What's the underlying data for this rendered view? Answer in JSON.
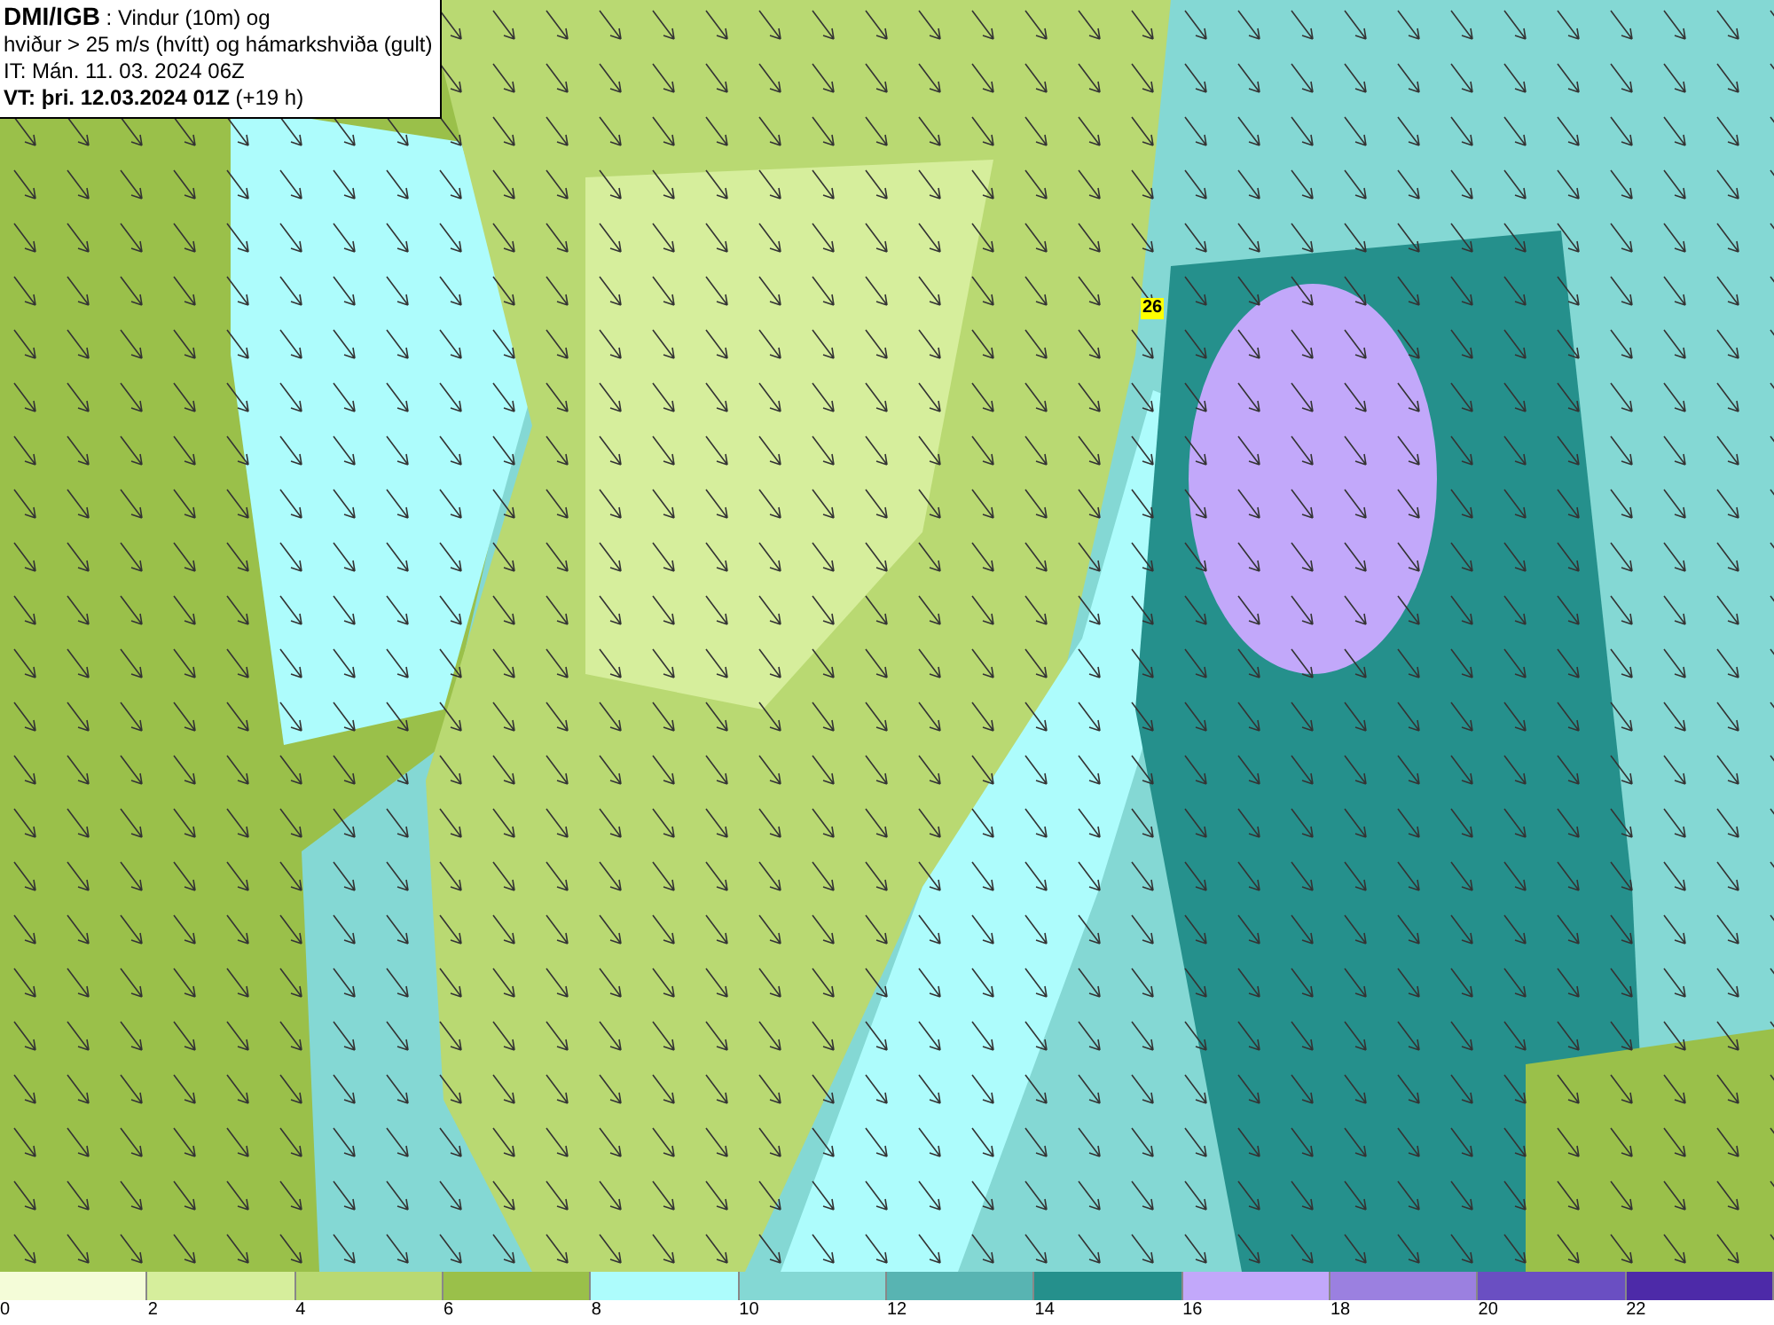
{
  "header": {
    "source": "DMI/IGB",
    "title_rest": ": Vindur (10m) og",
    "line_2": "hviður > 25 m/s (hvítt) og hámarkshviða (gult)",
    "issue_time": "IT: Mán. 11. 03. 2024 06Z",
    "valid_label": "VT: þri. 12.03.2024 01Z",
    "valid_offset": "(+19 h)"
  },
  "map": {
    "max_gust_marker": "26"
  },
  "legend": [
    {
      "color": "#f4fcd8",
      "label": "0"
    },
    {
      "color": "#d6ee9c",
      "label": "2"
    },
    {
      "color": "#b9d972",
      "label": "4"
    },
    {
      "color": "#9ac04a",
      "label": "6"
    },
    {
      "color": "#adfcfc",
      "label": "8"
    },
    {
      "color": "#84d8d4",
      "label": "10"
    },
    {
      "color": "#58b4b2",
      "label": "12"
    },
    {
      "color": "#25908c",
      "label": "14"
    },
    {
      "color": "#c2a8fa",
      "label": "16"
    },
    {
      "color": "#9b80e0",
      "label": "18"
    },
    {
      "color": "#6a4fc2",
      "label": "20"
    },
    {
      "color": "#4d2aa8",
      "label": "22"
    }
  ]
}
